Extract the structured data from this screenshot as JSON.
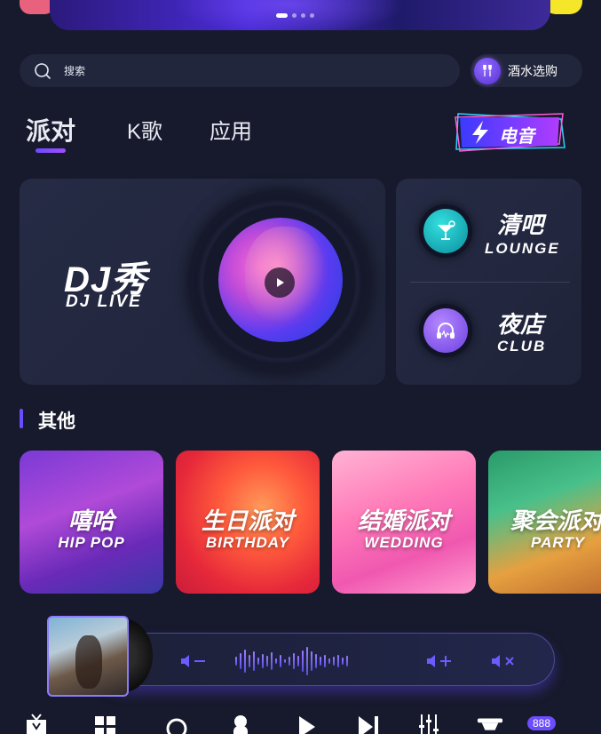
{
  "banner": {
    "active_index": 0,
    "dots": 4
  },
  "search": {
    "label": "搜索"
  },
  "drinks": {
    "label": "酒水选购"
  },
  "tabs": [
    {
      "label": "派对",
      "active": true
    },
    {
      "label": "K歌",
      "active": false
    },
    {
      "label": "应用",
      "active": false
    }
  ],
  "edm": {
    "label": "电音"
  },
  "dj": {
    "title": "DJ秀",
    "subtitle": "DJ LIVE"
  },
  "venues": [
    {
      "cn": "清吧",
      "en": "LOUNGE",
      "icon": "cocktail-icon"
    },
    {
      "cn": "夜店",
      "en": "CLUB",
      "icon": "headphones-icon"
    }
  ],
  "section": {
    "title": "其他"
  },
  "categories": [
    {
      "cn": "嘻哈",
      "en": "HIP POP"
    },
    {
      "cn": "生日派对",
      "en": "BIRTHDAY"
    },
    {
      "cn": "结婚派对",
      "en": "WEDDING"
    },
    {
      "cn": "聚会派对",
      "en": "PARTY"
    }
  ],
  "player": {
    "controls": [
      "volume-down-icon",
      "volume-up-icon",
      "mute-icon"
    ]
  },
  "nav": {
    "icons": [
      "gift-icon",
      "grid-icon",
      "refresh-icon",
      "singer-icon",
      "play-icon",
      "next-icon",
      "equalizer-icon",
      "light-icon"
    ],
    "badge": "888"
  },
  "colors": {
    "accent": "#6b4cff",
    "background": "#171a2c",
    "card": "#232840"
  }
}
